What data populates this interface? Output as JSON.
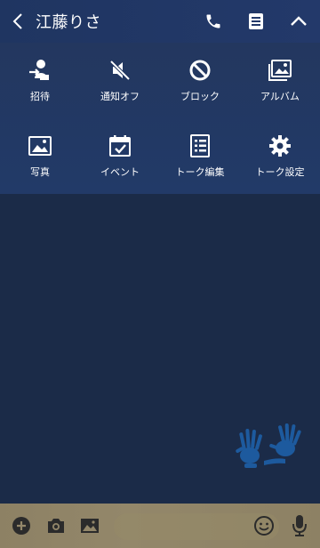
{
  "header": {
    "title": "江藤りさ",
    "icons": [
      "back-arrow-icon",
      "phone-icon",
      "notes-icon",
      "chevron-up-icon"
    ]
  },
  "menu": {
    "items": [
      {
        "label": "招待",
        "icon": "invite-icon"
      },
      {
        "label": "通知オフ",
        "icon": "mute-icon"
      },
      {
        "label": "ブロック",
        "icon": "block-icon"
      },
      {
        "label": "アルバム",
        "icon": "album-icon"
      },
      {
        "label": "写真",
        "icon": "photo-icon"
      },
      {
        "label": "イベント",
        "icon": "event-icon"
      },
      {
        "label": "トーク編集",
        "icon": "edit-talk-icon"
      },
      {
        "label": "トーク設定",
        "icon": "settings-icon"
      }
    ]
  },
  "footer": {
    "input_placeholder": "",
    "icons": [
      "add-icon",
      "camera-icon",
      "image-icon",
      "emoji-icon",
      "mic-icon"
    ]
  },
  "colors": {
    "header_bg": "#1f3561",
    "menu_bg": "#23375f",
    "chat_bg": "#1b2b48",
    "footer_bg": "#8d8164",
    "hand_accent": "#1d5a9e"
  }
}
